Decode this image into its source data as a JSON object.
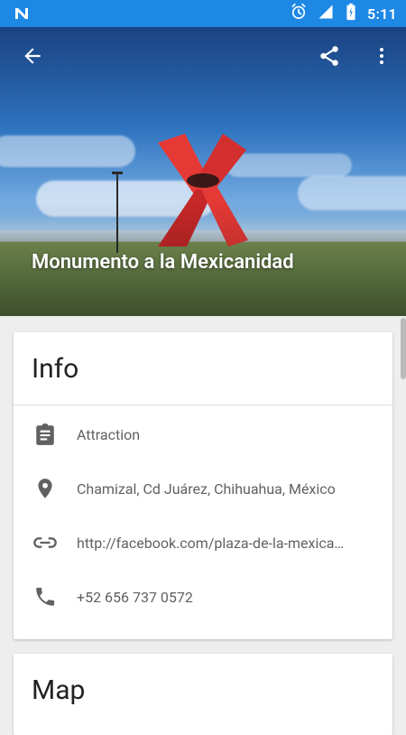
{
  "status_bar": {
    "time": "5:11",
    "icons": [
      "n-icon",
      "alarm-icon",
      "signal-icon",
      "battery-charging-icon"
    ],
    "color": "#1e88e5"
  },
  "hero": {
    "title": "Monumento a la Mexicanidad",
    "actions": {
      "back_icon": "back-arrow-icon",
      "share_icon": "share-icon",
      "more_icon": "more-vert-icon"
    }
  },
  "info_card": {
    "title": "Info",
    "rows": [
      {
        "icon": "clipboard-icon",
        "text": "Attraction"
      },
      {
        "icon": "location-pin-icon",
        "text": "Chamizal, Cd Juárez, Chihuahua, México"
      },
      {
        "icon": "link-icon",
        "text": "http://facebook.com/plaza-de-la-mexica…"
      },
      {
        "icon": "phone-icon",
        "text": "+52 656 737 0572"
      }
    ]
  },
  "map_card": {
    "title": "Map"
  }
}
